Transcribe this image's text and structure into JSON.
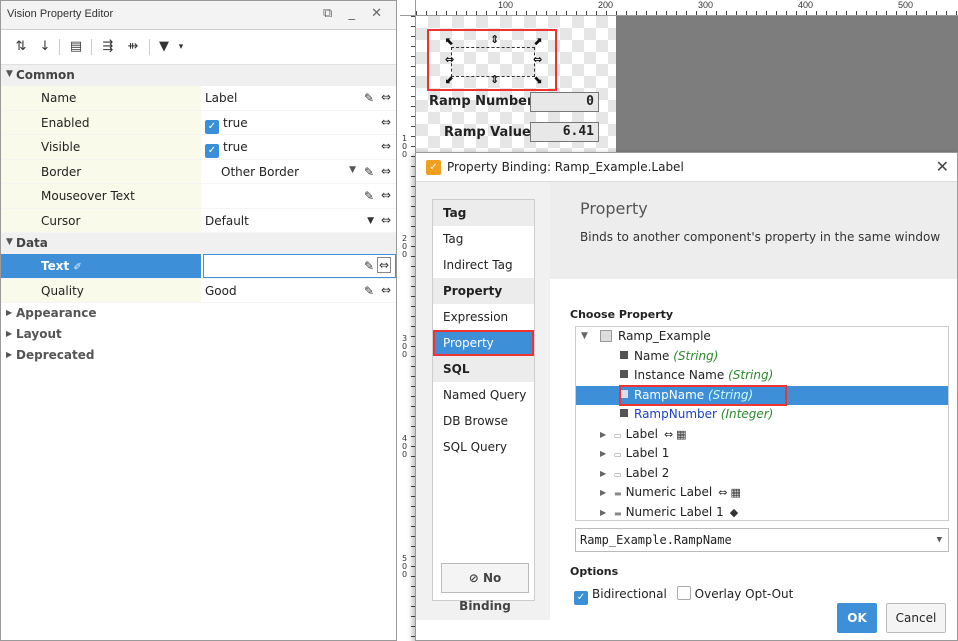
{
  "property_editor": {
    "title": "Vision Property Editor",
    "window_buttons": "⧉ _ ✕",
    "sections": {
      "common": "Common",
      "data": "Data",
      "appearance": "Appearance",
      "layout": "Layout",
      "deprecated": "Deprecated"
    },
    "rows": {
      "name": {
        "label": "Name",
        "value": "Label"
      },
      "enabled": {
        "label": "Enabled",
        "value": "true"
      },
      "visible": {
        "label": "Visible",
        "value": "true"
      },
      "border": {
        "label": "Border",
        "value": "Other Border"
      },
      "mouseover": {
        "label": "Mouseover Text",
        "value": ""
      },
      "cursor": {
        "label": "Cursor",
        "value": "Default"
      },
      "text": {
        "label": "Text",
        "value": ""
      },
      "quality": {
        "label": "Quality",
        "value": "Good"
      }
    },
    "accent_color": "#3d8fd8"
  },
  "designer": {
    "ruler_labels": [
      "100",
      "200",
      "300",
      "400",
      "500"
    ],
    "vruler_labels": [
      "100",
      "200",
      "300",
      "400",
      "500"
    ],
    "ramp_number_label": "Ramp Number",
    "ramp_number_value": "0",
    "ramp_value_label": "Ramp Value",
    "ramp_value_value": "6.41"
  },
  "dialog": {
    "title": "Property Binding: Ramp_Example.Label",
    "nav": {
      "groups": [
        "Tag",
        "Property",
        "SQL"
      ],
      "items": {
        "tag": "Tag",
        "indirect_tag": "Indirect Tag",
        "expression": "Expression",
        "property": "Property",
        "named_query": "Named Query",
        "db_browse": "DB Browse",
        "sql_query": "SQL Query"
      },
      "no_binding": "No Binding"
    },
    "header_title": "Property",
    "header_desc": "Binds to another component's property in the same window",
    "choose_property": "Choose Property",
    "tree": [
      {
        "text": "Ramp_Example",
        "type": ""
      },
      {
        "text": "Name",
        "type": "(String)"
      },
      {
        "text": "Instance Name",
        "type": "(String)"
      },
      {
        "text": "RampName",
        "type": "(String)"
      },
      {
        "text": "RampNumber",
        "type": "(Integer)"
      },
      {
        "text": "Label",
        "type": ""
      },
      {
        "text": "Label 1",
        "type": ""
      },
      {
        "text": "Label 2",
        "type": ""
      },
      {
        "text": "Numeric Label",
        "type": ""
      },
      {
        "text": "Numeric Label 1",
        "type": ""
      }
    ],
    "selected_path": "Ramp_Example.RampName",
    "options_label": "Options",
    "bidirectional": "Bidirectional",
    "overlay_opt_out": "Overlay Opt-Out",
    "ok": "OK",
    "cancel": "Cancel"
  }
}
